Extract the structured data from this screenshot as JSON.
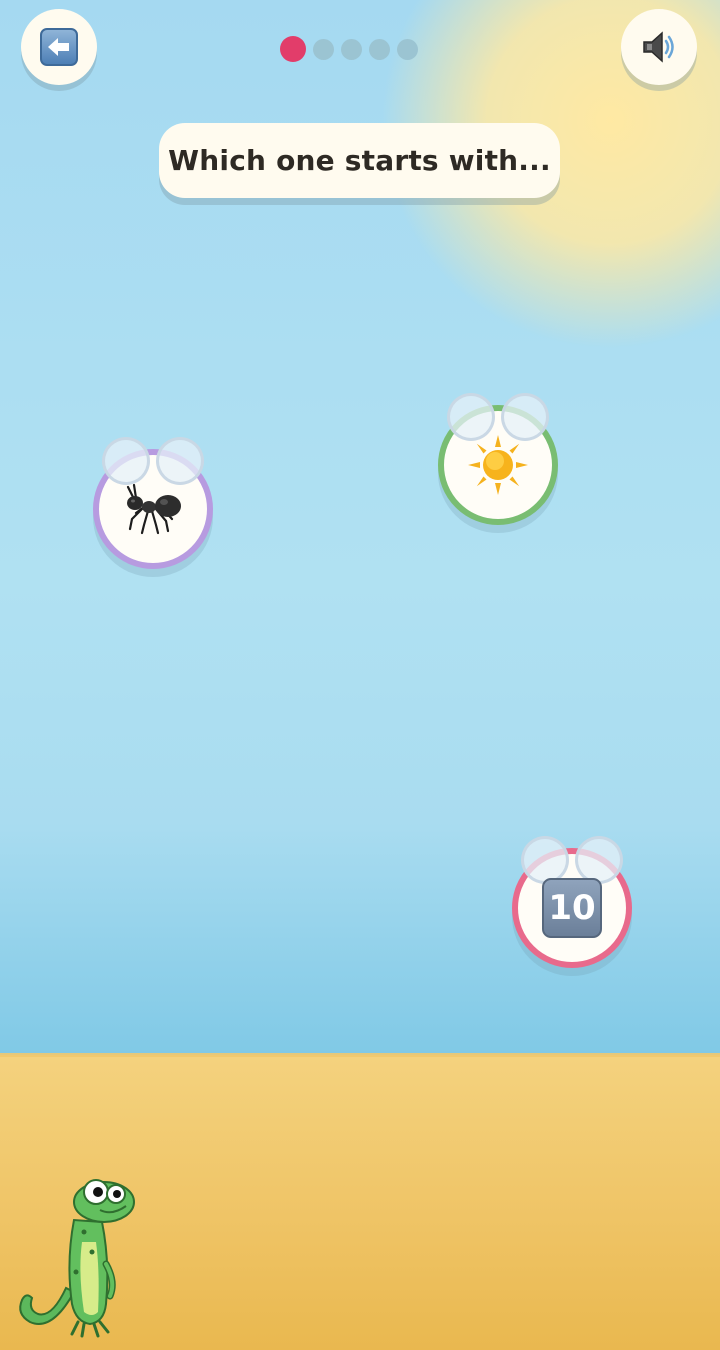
{
  "nav": {
    "back_icon": "back-arrow-icon",
    "sound_icon": "speaker-icon"
  },
  "progress": {
    "current": 1,
    "total": 5
  },
  "prompt": {
    "text": "Which one starts with..."
  },
  "choices": [
    {
      "id": "ant",
      "icon": "ant-icon",
      "ring_color": "#b79be0"
    },
    {
      "id": "sun",
      "icon": "sun-icon",
      "ring_color": "#79bd72"
    },
    {
      "id": "ten",
      "icon": "keycap-ten-icon",
      "label": "10",
      "ring_color": "#e86a8c"
    }
  ],
  "mascot": {
    "icon": "gecko-mascot"
  },
  "colors": {
    "accent": "#e23d6a",
    "sky": "#aee0f2",
    "sand": "#efc466",
    "card": "#fffbef"
  }
}
